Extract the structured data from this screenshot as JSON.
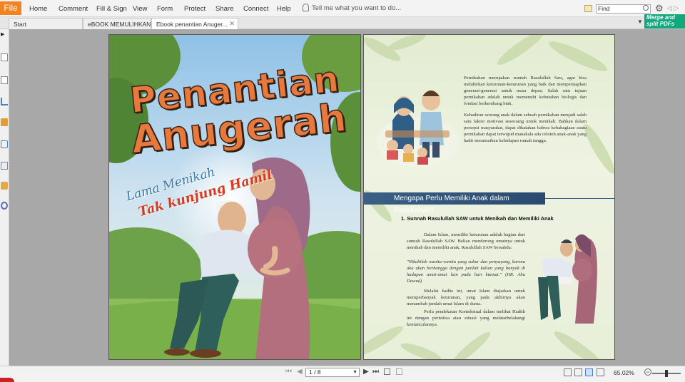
{
  "menu": {
    "file": "File",
    "items": [
      "Home",
      "Comment",
      "Fill & Sign",
      "View",
      "Form",
      "Protect",
      "Share",
      "Connect",
      "Help"
    ],
    "tell_me": "Tell me what you want to do...",
    "find_placeholder": "Find"
  },
  "tabs": [
    {
      "label": "Start",
      "active": false
    },
    {
      "label": "eBOOK MEMULIHKAN ...",
      "active": false
    },
    {
      "label": "Ebook penantian Anuger...",
      "active": true
    }
  ],
  "merge_banner": {
    "line1": "Merge and",
    "line2": "split PDFs"
  },
  "cover": {
    "title_line1": "Penantian",
    "title_line2": "Anugerah",
    "subtitle1": "Lama Menikah",
    "subtitle2": "Tak kunjung Hamil"
  },
  "inner": {
    "para1": "Pernikahan merupakan sunnah Rasulullah Saw, agar bisa melahirkan keturunan-keturunan yang baik dan mempersiapkan generasi-generasi untuk masa depan. Salah satu tujuan pernikahan adalah untuk memenuhi kebutuhan biologis dan fondasi berkembang biak.",
    "para2": "Kehadiran seorang anak dalam sebuah pernikahan menjadi salah satu faktor motivasi seseorang untuk menikah. Bahkan dalam persepsi masyarakat, dapat dikatakan bahwa kebahagiaan suatu pernikahan dapat terwujud manakala ada celoteh anak-anak yang hadir meramaikan kehidupan rumah tangga.",
    "heading": "Mengapa Perlu Memiliki Anak dalam Pernikahan?",
    "subheading": "1.  Sunnah Rasulullah SAW untuk Menikah dan Memiliki Anak",
    "body1": "Dalam Islam, memiliki keturunan adalah bagian dari sunnah Rasulullah SAW. Beliau mendorong umatnya untuk menikah dan memiliki anak. Rasulullah SAW bersabda:",
    "hadith": "\"Nikahilah wanita-wanita yang subur dan penyayang, karena aku akan berbangga dengan jumlah kalian yang banyak di hadapan umat-umat lain pada hari kiamat.\" (HR. Abu Dawud)",
    "body2": "Melalui hadits ini, umat Islam diajarkan untuk memperbanyak keturunan, yang pada akhirnya akan menambah jumlah umat Islam di dunia.",
    "body3": "Perlu pendekatan Kontekstual dalam melihat Hadith ini dengan peristiwa atau situasi yang melatarbelakangi kemunculannya."
  },
  "status": {
    "page": "1 / 8",
    "zoom": "65.02%"
  },
  "colors": {
    "file_tab": "#f58220",
    "merge_banner": "#11a87e",
    "heading_bar": "#3c5f86",
    "title_orange": "#e8793d"
  }
}
